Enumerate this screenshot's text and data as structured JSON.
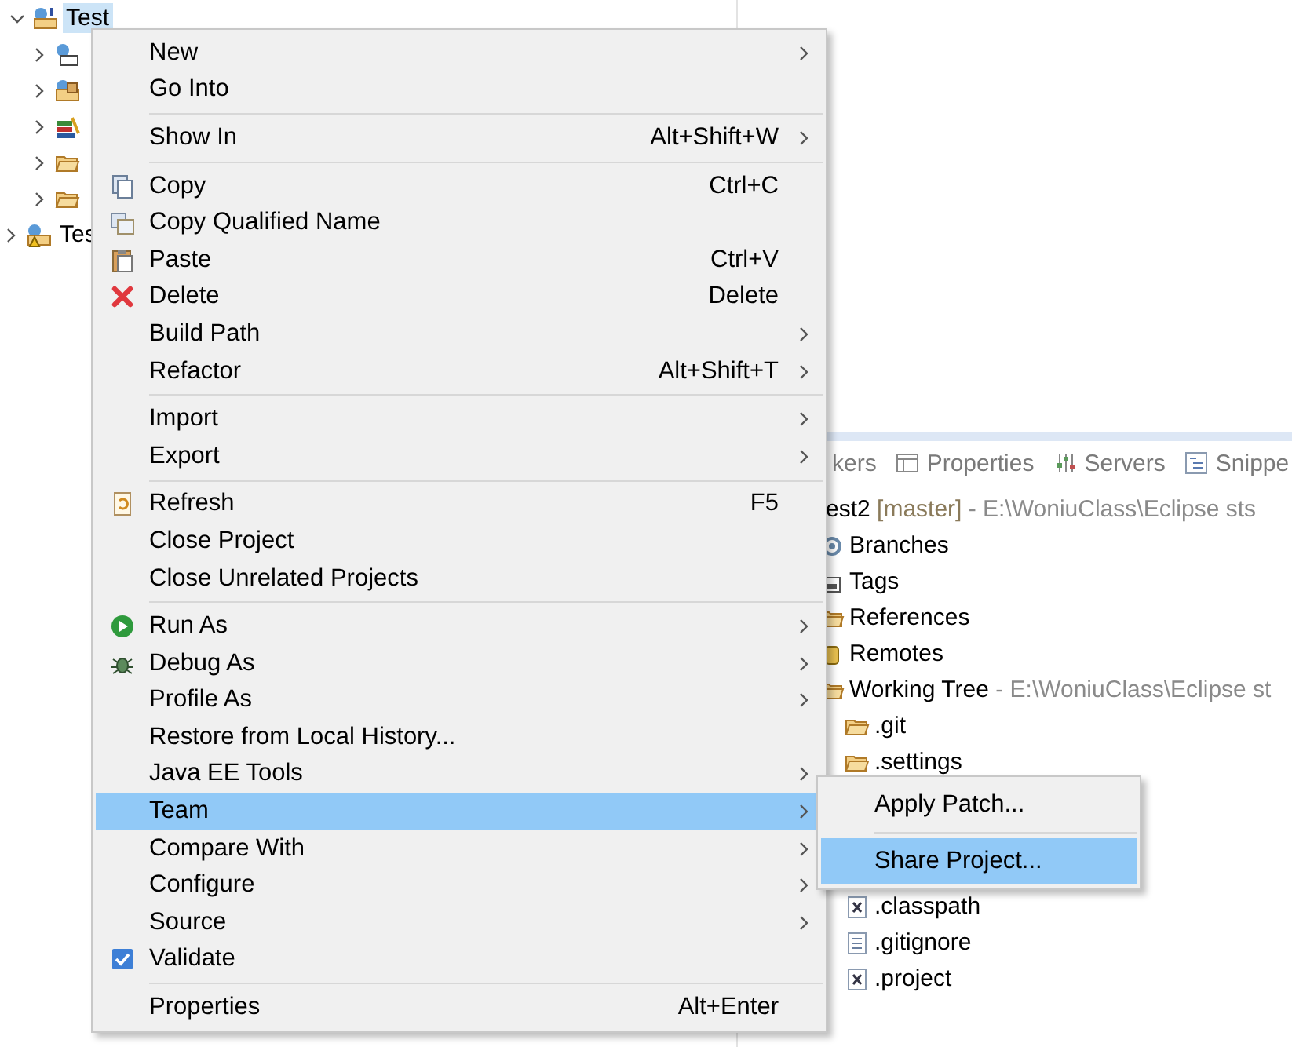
{
  "project_tree": {
    "root": {
      "label": "Test",
      "expanded": true,
      "selected": true
    },
    "children": [
      {
        "kind": "library"
      },
      {
        "kind": "package"
      },
      {
        "kind": "books"
      },
      {
        "kind": "folder"
      },
      {
        "kind": "folder"
      }
    ],
    "siblings": [
      {
        "label": "Tes",
        "expanded": false,
        "selected": false
      }
    ]
  },
  "context_menu": {
    "items": [
      {
        "kind": "item",
        "label": "New",
        "submenu": true,
        "selected": false
      },
      {
        "kind": "item",
        "label": "Go Into",
        "submenu": false,
        "selected": false
      },
      {
        "kind": "separator"
      },
      {
        "kind": "item",
        "label": "Show In",
        "shortcut": "Alt+Shift+W",
        "submenu": true,
        "selected": false
      },
      {
        "kind": "separator"
      },
      {
        "kind": "item",
        "label": "Copy",
        "shortcut": "Ctrl+C",
        "submenu": false,
        "selected": false
      },
      {
        "kind": "item",
        "label": "Copy Qualified Name",
        "submenu": false,
        "selected": false
      },
      {
        "kind": "item",
        "label": "Paste",
        "shortcut": "Ctrl+V",
        "submenu": false,
        "selected": false
      },
      {
        "kind": "item",
        "label": "Delete",
        "shortcut": "Delete",
        "submenu": false,
        "selected": false
      },
      {
        "kind": "item",
        "label": "Build Path",
        "submenu": true,
        "selected": false
      },
      {
        "kind": "item",
        "label": "Refactor",
        "shortcut": "Alt+Shift+T",
        "submenu": true,
        "selected": false
      },
      {
        "kind": "separator"
      },
      {
        "kind": "item",
        "label": "Import",
        "submenu": true,
        "selected": false
      },
      {
        "kind": "item",
        "label": "Export",
        "submenu": true,
        "selected": false
      },
      {
        "kind": "separator"
      },
      {
        "kind": "item",
        "label": "Refresh",
        "shortcut": "F5",
        "submenu": false,
        "selected": false
      },
      {
        "kind": "item",
        "label": "Close Project",
        "submenu": false,
        "selected": false
      },
      {
        "kind": "item",
        "label": "Close Unrelated Projects",
        "submenu": false,
        "selected": false
      },
      {
        "kind": "separator"
      },
      {
        "kind": "item",
        "label": "Run As",
        "submenu": true,
        "selected": false
      },
      {
        "kind": "item",
        "label": "Debug As",
        "submenu": true,
        "selected": false
      },
      {
        "kind": "item",
        "label": "Profile As",
        "submenu": true,
        "selected": false
      },
      {
        "kind": "item",
        "label": "Restore from Local History...",
        "submenu": false,
        "selected": false
      },
      {
        "kind": "item",
        "label": "Java EE Tools",
        "submenu": true,
        "selected": false
      },
      {
        "kind": "item",
        "label": "Team",
        "submenu": true,
        "selected": true
      },
      {
        "kind": "item",
        "label": "Compare With",
        "submenu": true,
        "selected": false
      },
      {
        "kind": "item",
        "label": "Configure",
        "submenu": true,
        "selected": false
      },
      {
        "kind": "item",
        "label": "Source",
        "submenu": true,
        "selected": false
      },
      {
        "kind": "item",
        "label": "Validate",
        "submenu": false,
        "selected": false
      },
      {
        "kind": "separator"
      },
      {
        "kind": "item",
        "label": "Properties",
        "shortcut": "Alt+Enter",
        "submenu": false,
        "selected": false
      }
    ]
  },
  "team_submenu": {
    "items": [
      {
        "kind": "item",
        "label": "Apply Patch...",
        "selected": false
      },
      {
        "kind": "separator"
      },
      {
        "kind": "item",
        "label": "Share Project...",
        "selected": true
      }
    ]
  },
  "view_tabs": [
    {
      "label": "kers"
    },
    {
      "label": "Properties"
    },
    {
      "label": "Servers"
    },
    {
      "label": "Snippe"
    }
  ],
  "git_tree": {
    "root": {
      "label": "est2",
      "branch": "[master]",
      "path": "- E:\\WoniuClass\\Eclipse sts"
    },
    "children": [
      {
        "label": "Branches"
      },
      {
        "label": "Tags"
      },
      {
        "label": "References"
      },
      {
        "label": "Remotes"
      },
      {
        "label": "Working Tree",
        "path": "- E:\\WoniuClass\\Eclipse st",
        "children": [
          {
            "label": ".git",
            "kind": "folder"
          },
          {
            "label": ".settings",
            "kind": "folder"
          },
          {
            "label": ".classpath",
            "kind": "xml"
          },
          {
            "label": ".gitignore",
            "kind": "text"
          },
          {
            "label": ".project",
            "kind": "xml"
          }
        ]
      }
    ]
  }
}
